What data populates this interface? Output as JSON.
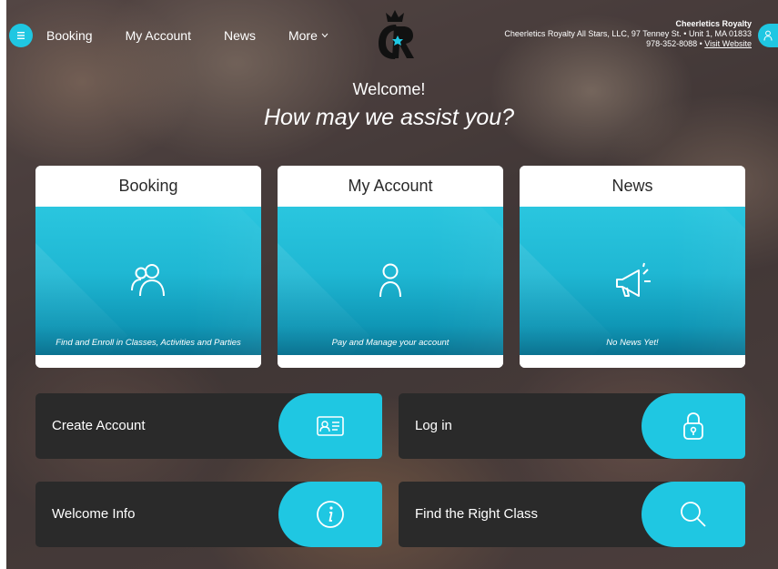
{
  "nav": {
    "menu_icon": "hamburger-icon",
    "items": [
      "Booking",
      "My Account",
      "News",
      "More"
    ],
    "more_chevron": "chevron-down-icon",
    "user_icon": "user-icon"
  },
  "brand": {
    "logo_text": "CR",
    "org_name": "Cheerletics Royalty",
    "address": "Cheerletics Royalty All Stars, LLC, 97 Tenney St. • Unit 1, MA 01833",
    "phone": "978-352-8088",
    "separator": " • ",
    "visit_link": "Visit Website"
  },
  "hero": {
    "welcome": "Welcome!",
    "assist": "How may we assist you?"
  },
  "cards": [
    {
      "title": "Booking",
      "caption": "Find and Enroll in Classes, Activities and Parties",
      "icon": "people-icon"
    },
    {
      "title": "My Account",
      "caption": "Pay and Manage your account",
      "icon": "user-icon"
    },
    {
      "title": "News",
      "caption": "No News Yet!",
      "icon": "megaphone-icon"
    }
  ],
  "actions": [
    {
      "label": "Create Account",
      "icon": "id-card-icon"
    },
    {
      "label": "Log in",
      "icon": "lock-icon"
    },
    {
      "label": "Welcome Info",
      "icon": "info-icon"
    },
    {
      "label": "Find the Right Class",
      "icon": "search-icon"
    }
  ],
  "colors": {
    "accent": "#1fc7e2",
    "dark_button": "#2a2a2a",
    "card_header": "#ffffff"
  }
}
